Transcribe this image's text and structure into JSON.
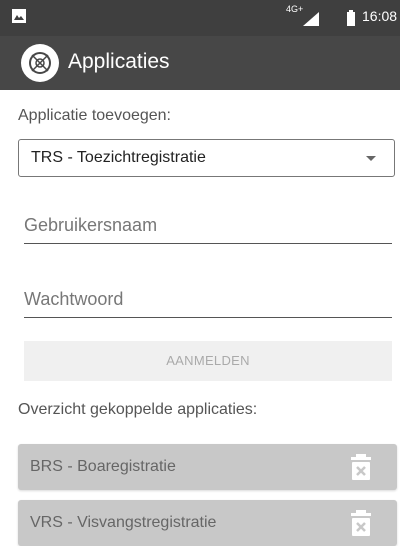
{
  "status_bar": {
    "network": "4G+",
    "time": "16:08",
    "icons": [
      "notification-icon",
      "signal-icon",
      "battery-icon"
    ]
  },
  "app_bar": {
    "title": "Applicaties",
    "logo_icon": "app-logo-icon"
  },
  "add_section": {
    "label": "Applicatie toevoegen:",
    "selected_application": "TRS - Toezichtregistratie",
    "username_placeholder": "Gebruikersnaam",
    "username_value": "",
    "password_placeholder": "Wachtwoord",
    "password_value": "",
    "login_button": "AANMELDEN"
  },
  "linked_section": {
    "label": "Overzicht gekoppelde applicaties:",
    "items": [
      {
        "label": "BRS - Boaregistratie",
        "action_icon": "trash-icon"
      },
      {
        "label": "VRS - Visvangstregistratie",
        "action_icon": "trash-icon"
      }
    ]
  },
  "colors": {
    "status_bar": "#3f3f3f",
    "app_bar": "#474747",
    "item_background": "#c8c8c8",
    "button_disabled": "#f0f0f0"
  }
}
